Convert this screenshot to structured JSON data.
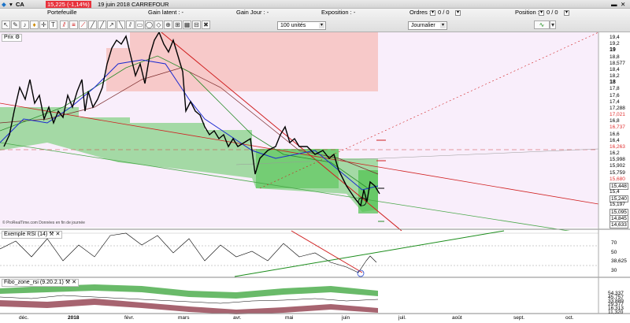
{
  "window": {
    "symbol": "CA",
    "price_badge": "15,225 (-1,14%)",
    "title": "19 juin 2018 CARREFOUR",
    "portefeuille": "Portefeuille",
    "gain_latent": "Gain latent : -",
    "gain_jour": "Gain Jour : -",
    "exposition": "Exposition : -",
    "ordres_label": "Ordres :",
    "ordres_value": "0 / 0",
    "position_label": "Position :",
    "position_value": "0 / 0"
  },
  "toolbar": {
    "quantity": "100 unités",
    "period": "Journalier"
  },
  "panels": {
    "price": {
      "label": "Prix"
    },
    "rsi": {
      "label": "Exemple RSI (14)"
    },
    "fibo": {
      "label": "Fibo_zone_rsi (9.20.2.1)"
    }
  },
  "price_axis": {
    "ticks": [
      "19,4",
      "19,2",
      "19",
      "18,8",
      "18,577",
      "18,4",
      "18,2",
      "18",
      "17,8",
      "17,6",
      "17,4",
      "17,288",
      "17,021",
      "16,8",
      "16,737",
      "16,6",
      "16,4",
      "16,263",
      "16,2",
      "15,998",
      "15,902",
      "15,759",
      "15,680",
      "15,448",
      "15,4",
      "15,240",
      "15,197",
      "15,095",
      "14,845",
      "14,633"
    ],
    "bold": [
      "19",
      "18"
    ],
    "red": [
      "17,021",
      "16,737",
      "16,263",
      "15,680"
    ],
    "boxed": [
      "15,448",
      "15,240",
      "15,095",
      "14,845",
      "14,633"
    ]
  },
  "rsi_axis": {
    "ticks": [
      "70",
      "50",
      "38,625",
      "30"
    ]
  },
  "fibo_axis": {
    "ticks": [
      "54,337",
      "45,757",
      "33,889",
      "29,377",
      "16,313",
      "11,320"
    ]
  },
  "x_axis": {
    "ticks": [
      "déc.",
      "2018",
      "févr.",
      "mars",
      "avr.",
      "mai",
      "juin",
      "juil.",
      "août",
      "sept.",
      "oct."
    ]
  },
  "footnote": "© ProRealTime.com Données en fin de journée",
  "colors": {
    "accent_red": "#e8323c",
    "green_zone": "#5fc95f",
    "pink_zone": "#f7c9c9",
    "chart_bg": "#f9eefb"
  },
  "icons": [
    "prt-logo-icon",
    "pencil-icon",
    "bell-icon",
    "cursor-icon",
    "text-icon",
    "trendline-icon",
    "channel-icon",
    "fibonacci-icon",
    "delete-icon",
    "indicator-icon"
  ]
}
